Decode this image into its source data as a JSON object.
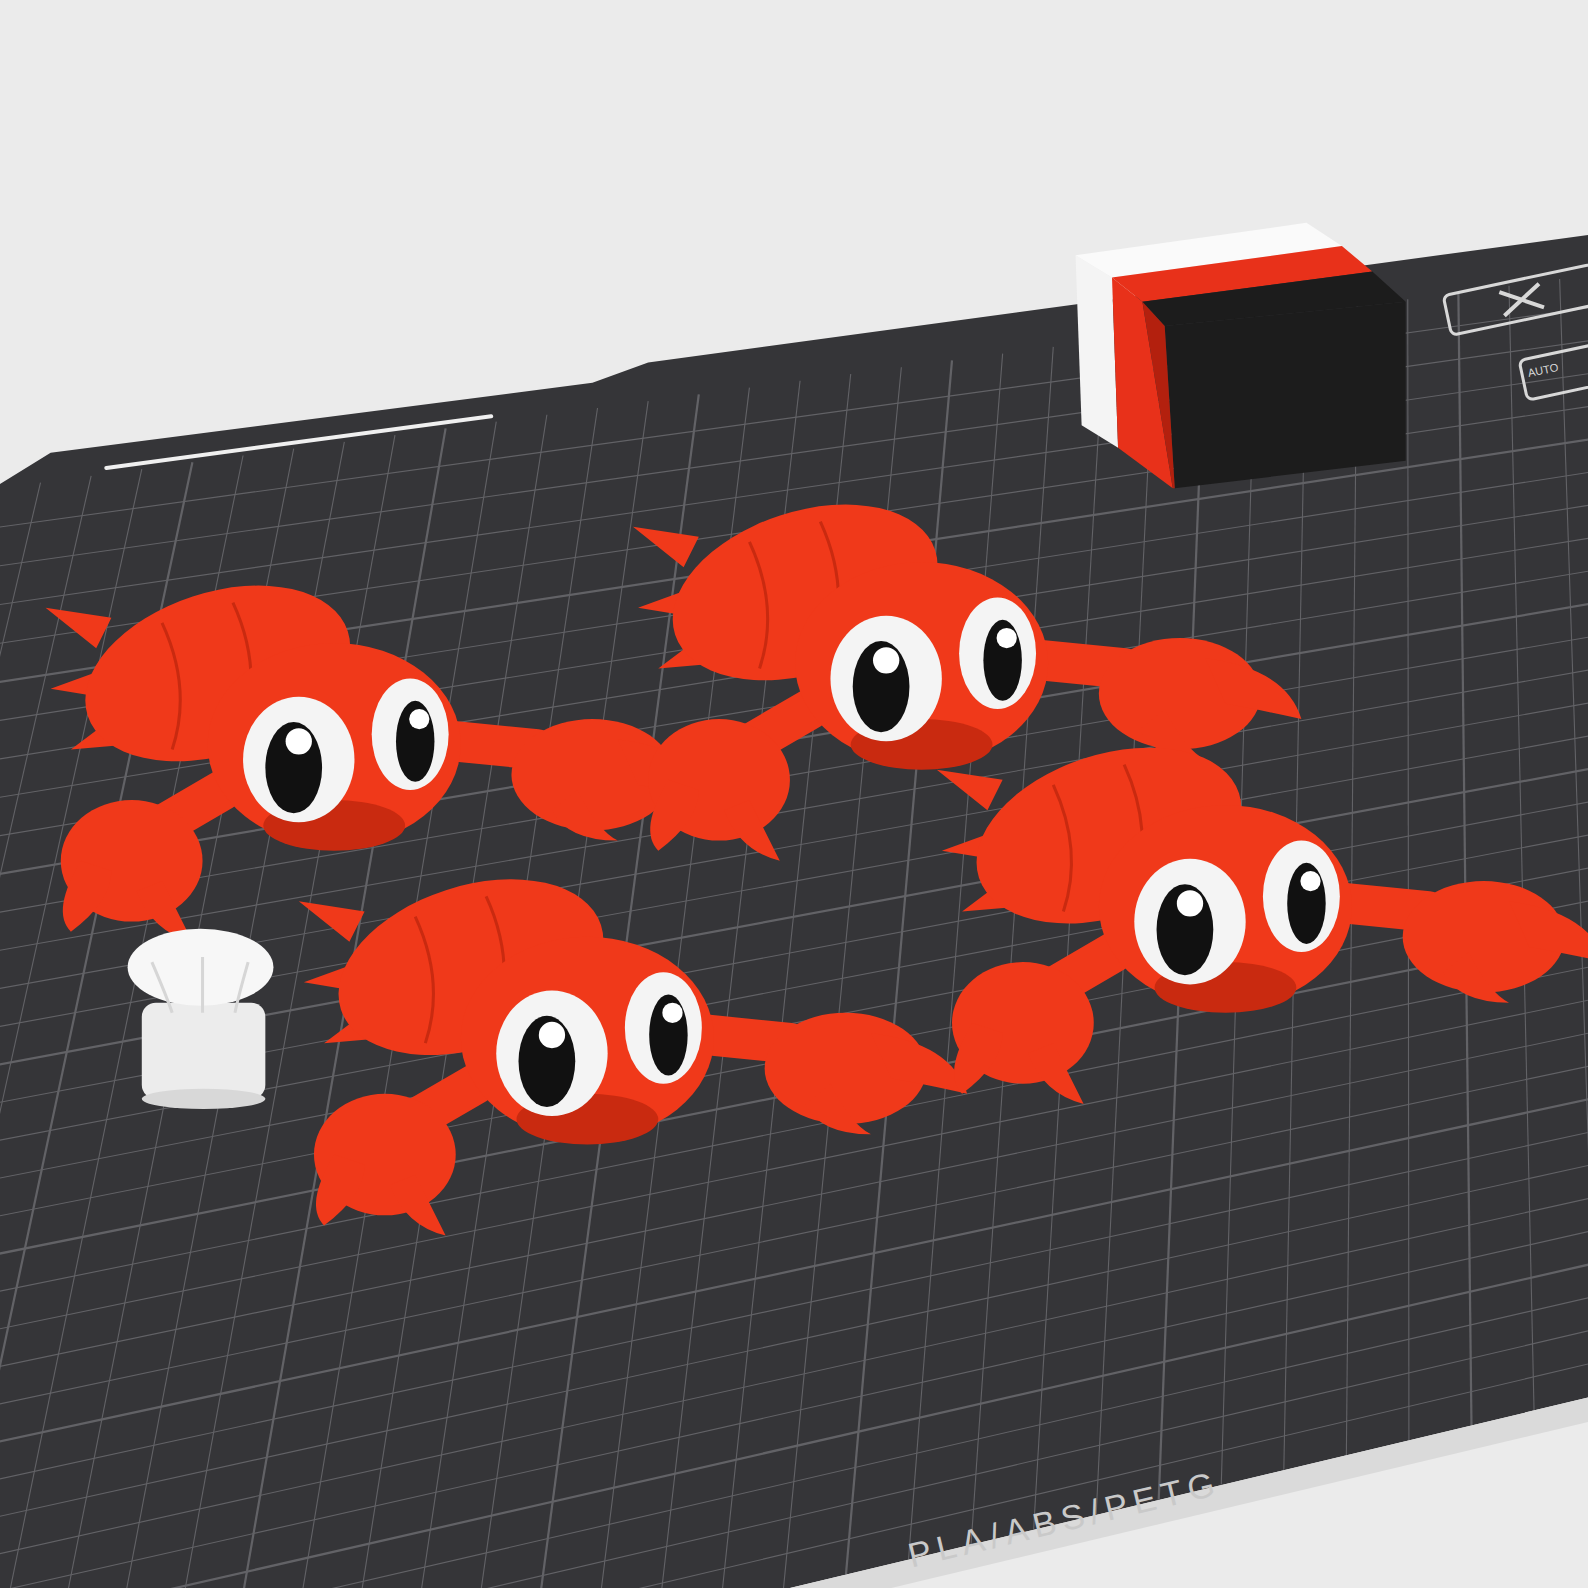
{
  "plate": {
    "label": "PLA/ABS/PETG"
  },
  "plate_icons": [
    {
      "label": "AUTO"
    }
  ],
  "wipe_tower": {
    "layers": [
      {
        "color": "#f4f4f4"
      },
      {
        "color": "#e8311a"
      },
      {
        "color": "#1c1c1c"
      }
    ]
  }
}
